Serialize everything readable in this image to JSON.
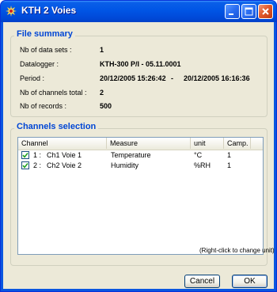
{
  "window": {
    "title": "KTH 2 Voies"
  },
  "file_summary": {
    "title": "File summary",
    "rows": [
      {
        "label": "Nb of data sets :",
        "value": "1"
      },
      {
        "label": "Datalogger :",
        "value": "KTH-300 P/I - 05.11.0001"
      },
      {
        "label": "Period :",
        "value": "20/12/2005 15:26:42",
        "sep": "-",
        "value2": "20/12/2005 16:16:36"
      },
      {
        "label": "Nb of channels total :",
        "value": "2"
      },
      {
        "label": "Nb of records :",
        "value": "500"
      }
    ]
  },
  "channels": {
    "title": "Channels selection",
    "columns": [
      "Channel",
      "Measure",
      "unit",
      "Camp."
    ],
    "rows": [
      {
        "checked": true,
        "num": "1 :",
        "name": "Ch1 Voie 1",
        "measure": "Temperature",
        "unit": "°C",
        "camp": "1"
      },
      {
        "checked": true,
        "num": "2 :",
        "name": "Ch2 Voie 2",
        "measure": "Humidity",
        "unit": "%RH",
        "camp": "1"
      }
    ],
    "hint": "(Right-click to change unit)"
  },
  "buttons": {
    "cancel": "Cancel",
    "ok": "OK"
  },
  "colors": {
    "titlebar": "#0055e5",
    "group_title": "#0046d5",
    "dialog_bg": "#ece9d8"
  }
}
